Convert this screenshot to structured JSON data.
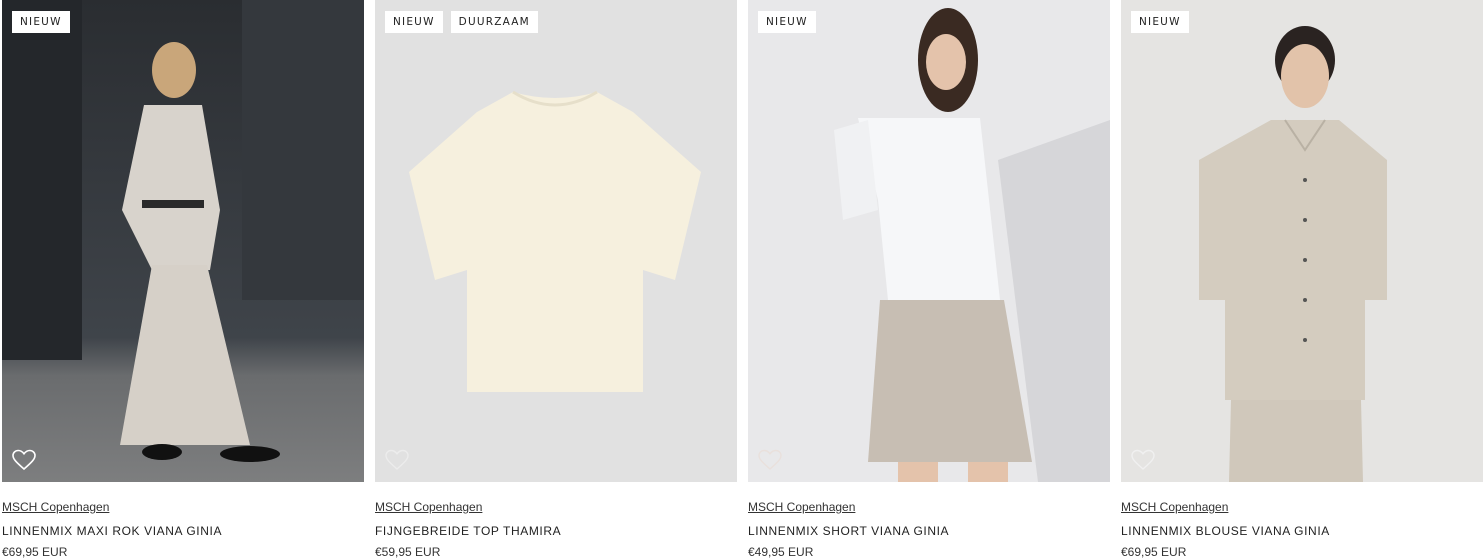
{
  "products": [
    {
      "badges": [
        "NIEUW"
      ],
      "brand": "MSCH Copenhagen",
      "name": "LINNENMIX MAXI ROK VIANA GINIA",
      "price": "€69,95 EUR",
      "wishlist_icon": "heart-icon",
      "image_desc_colors": {
        "bg": "#3b3f45",
        "garment": "#cfc8bf"
      }
    },
    {
      "badges": [
        "NIEUW",
        "DUURZAAM"
      ],
      "brand": "MSCH Copenhagen",
      "name": "FIJNGEBREIDE TOP THAMIRA",
      "price": "€59,95 EUR",
      "wishlist_icon": "heart-icon",
      "image_desc_colors": {
        "bg": "#e1e1e1",
        "garment": "#f6f0de"
      }
    },
    {
      "badges": [
        "NIEUW"
      ],
      "brand": "MSCH Copenhagen",
      "name": "LINNENMIX SHORT VIANA GINIA",
      "price": "€49,95 EUR",
      "wishlist_icon": "heart-icon",
      "image_desc_colors": {
        "bg": "#e6e6e8",
        "garment": "#c7beb3"
      }
    },
    {
      "badges": [
        "NIEUW"
      ],
      "brand": "MSCH Copenhagen",
      "name": "LINNENMIX BLOUSE VIANA GINIA",
      "price": "€69,95 EUR",
      "wishlist_icon": "heart-icon",
      "image_desc_colors": {
        "bg": "#e5e4e2",
        "garment": "#d4ccbf"
      }
    }
  ]
}
